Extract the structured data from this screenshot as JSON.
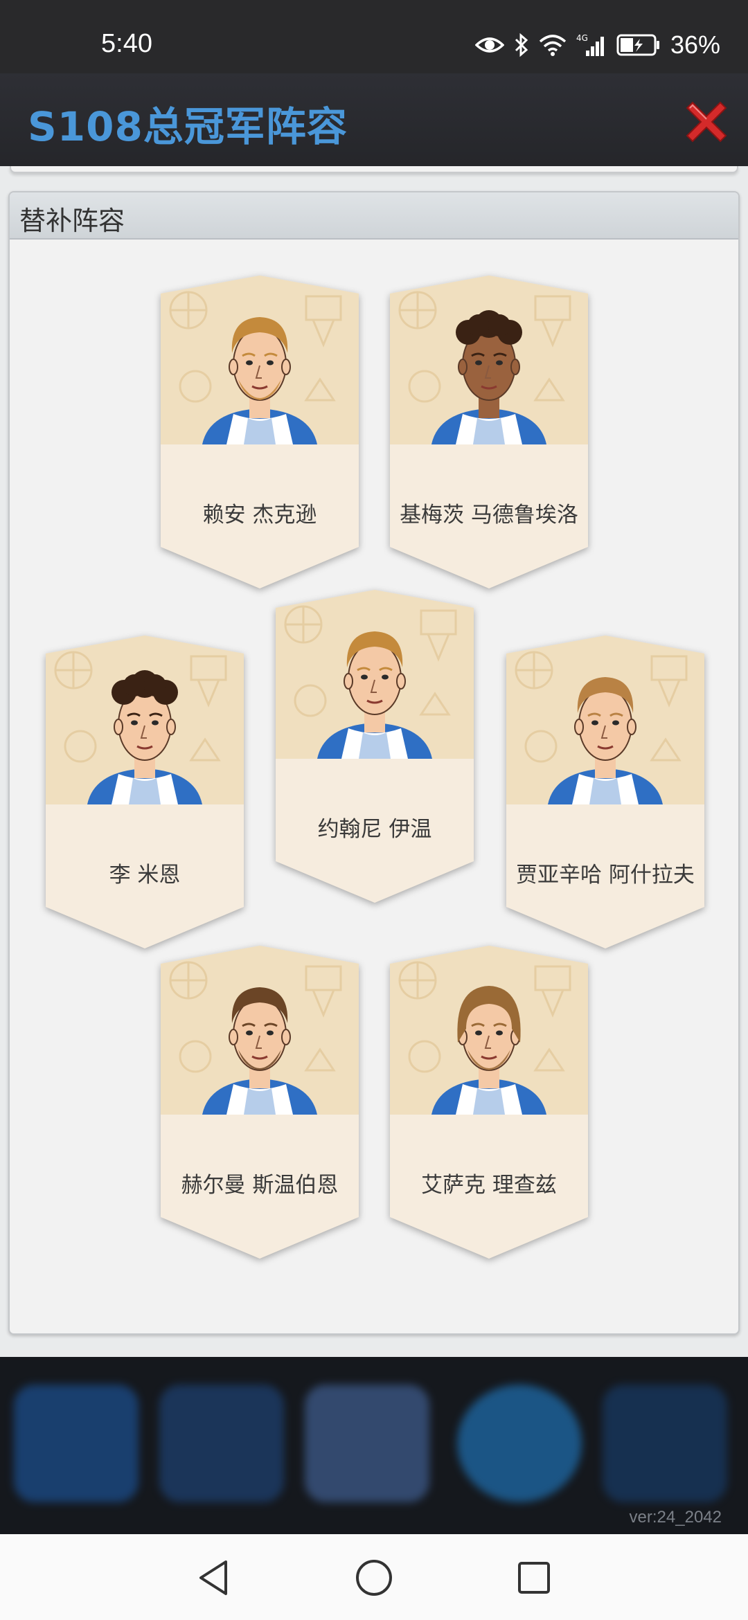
{
  "status_bar": {
    "time": "5:40",
    "battery_percent": "36%",
    "icons": [
      "eye-icon",
      "bluetooth-icon",
      "wifi-icon",
      "cellular-4g-icon",
      "battery-charging-icon"
    ]
  },
  "dialog": {
    "title": "S108总冠军阵容",
    "close_icon": "close-x-icon",
    "accent_color": "#4a97d9",
    "close_color": "#d42a2a"
  },
  "bench_panel": {
    "title": "替补阵容",
    "players": [
      {
        "name": "赖安 杰克逊",
        "hair": "blond",
        "skin": "light",
        "beard": true
      },
      {
        "name": "基梅茨 马德鲁埃洛",
        "hair": "dark-curly",
        "skin": "brown",
        "beard": false
      },
      {
        "name": "李 米恩",
        "hair": "dark-curly",
        "skin": "light",
        "beard": false
      },
      {
        "name": "约翰尼 伊温",
        "hair": "blond",
        "skin": "light",
        "beard": false
      },
      {
        "name": "贾亚辛哈 阿什拉夫",
        "hair": "light-brown",
        "skin": "light",
        "beard": false
      },
      {
        "name": "赫尔曼 斯温伯恩",
        "hair": "brown",
        "skin": "light",
        "beard": true
      },
      {
        "name": "艾萨克 理查兹",
        "hair": "long-brown",
        "skin": "light",
        "beard": true
      }
    ]
  },
  "bottom_bar": {
    "version": "ver:24_2042",
    "icons": [
      "star-icon",
      "yen-icon",
      "court-icon",
      "chat-icon",
      "chevron-up-icon"
    ]
  },
  "nav_bar": {
    "icons": [
      "back-icon",
      "home-icon",
      "recents-icon"
    ]
  }
}
